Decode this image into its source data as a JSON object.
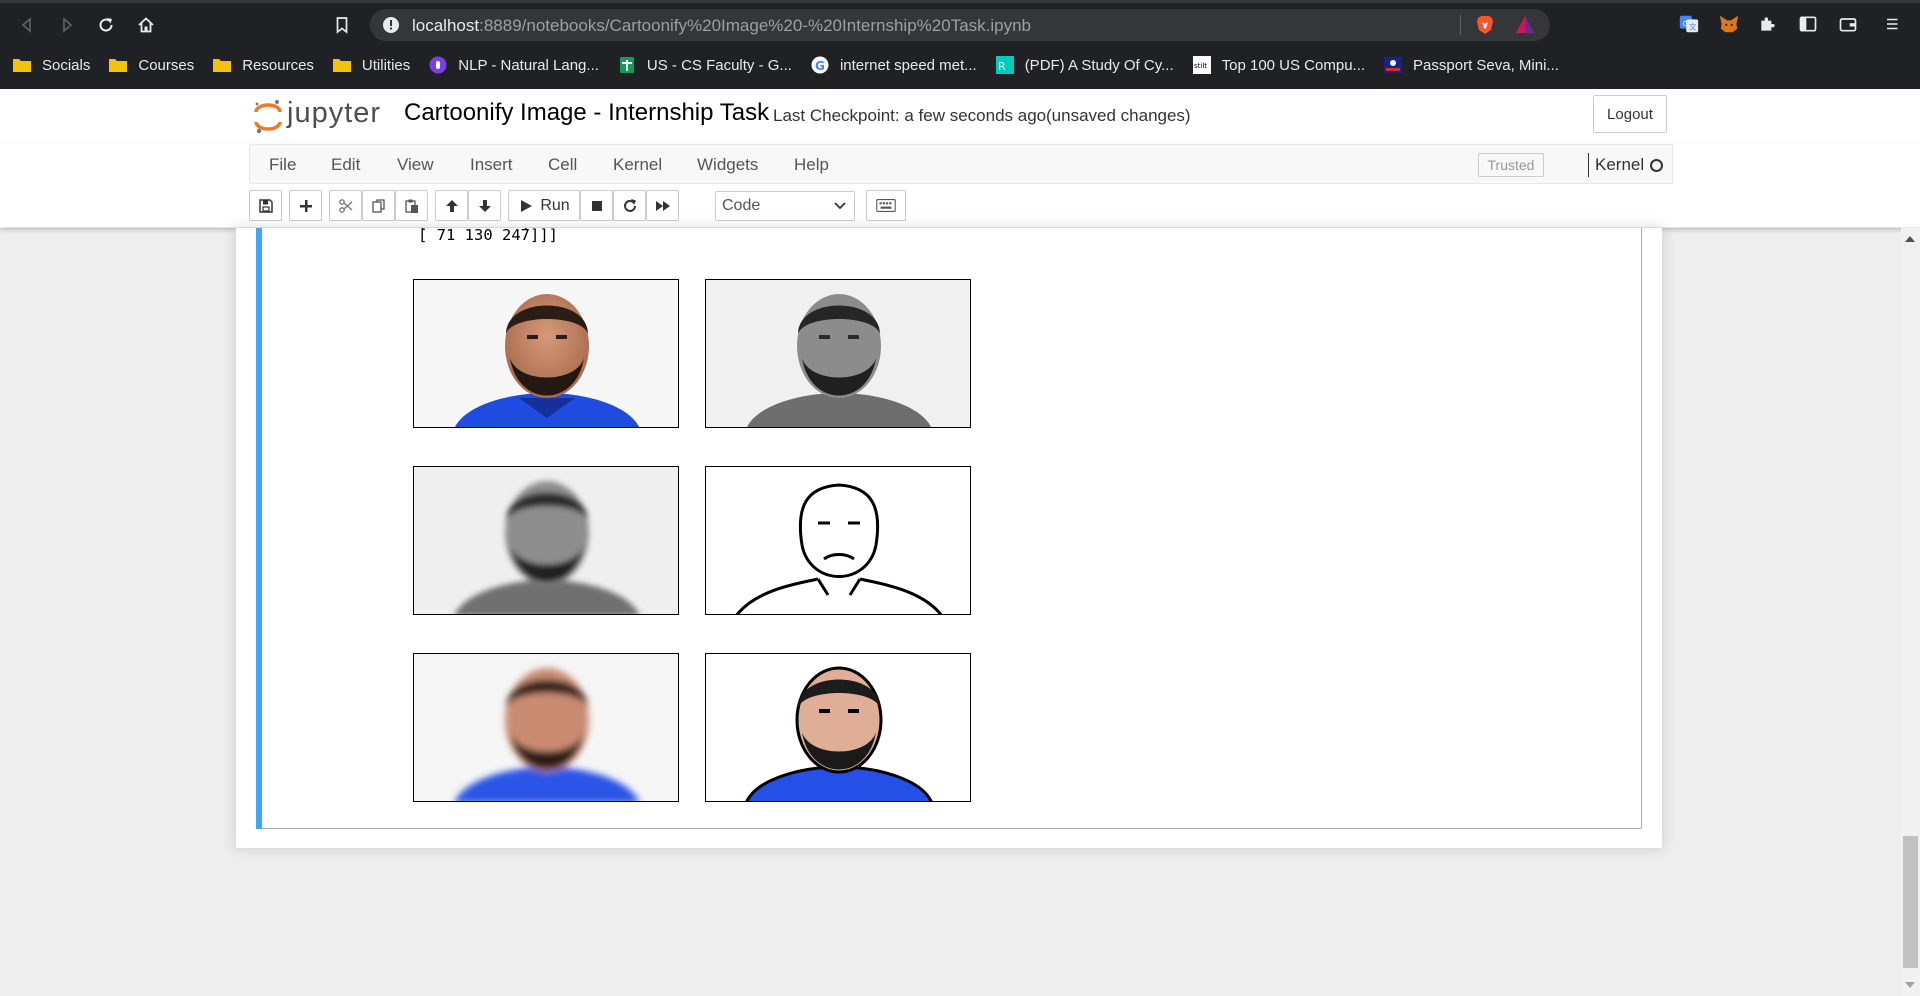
{
  "browser": {
    "url_host": "localhost",
    "url_path": ":8889/notebooks/Cartoonify%20Image%20-%20Internship%20Task.ipynb",
    "bookmarks": [
      {
        "label": "Socials",
        "icon": "folder-icon"
      },
      {
        "label": "Courses",
        "icon": "folder-icon"
      },
      {
        "label": "Resources",
        "icon": "folder-icon"
      },
      {
        "label": "Utilities",
        "icon": "folder-icon"
      },
      {
        "label": "NLP - Natural Lang...",
        "icon": "nlp-site-icon"
      },
      {
        "label": "US - CS Faculty - G...",
        "icon": "sheets-icon"
      },
      {
        "label": "internet speed met...",
        "icon": "google-icon"
      },
      {
        "label": "(PDF) A Study Of Cy...",
        "icon": "researchgate-icon"
      },
      {
        "label": "Top 100 US Compu...",
        "icon": "stilt-icon"
      },
      {
        "label": "Passport Seva, Mini...",
        "icon": "passport-icon"
      }
    ]
  },
  "jupyter": {
    "logo_text": "jupyter",
    "notebook_title": "Cartoonify Image - Internship Task",
    "checkpoint": "Last Checkpoint: a few seconds ago",
    "save_status": "(unsaved changes)",
    "logout_label": "Logout",
    "menus": [
      "File",
      "Edit",
      "View",
      "Insert",
      "Cell",
      "Kernel",
      "Widgets",
      "Help"
    ],
    "trusted_label": "Trusted",
    "kernel_label": "Kernel",
    "run_label": "Run",
    "cell_type": "Code"
  },
  "output": {
    "text_line": "[ 71 130 247]]]",
    "images": [
      {
        "name": "original-image",
        "style": "color"
      },
      {
        "name": "grayscale-image",
        "style": "gray"
      },
      {
        "name": "blurred-grayscale-image",
        "style": "gray-blur"
      },
      {
        "name": "edge-mask-image",
        "style": "edges"
      },
      {
        "name": "bilateral-filtered-image",
        "style": "color-blur"
      },
      {
        "name": "cartoon-image",
        "style": "cartoon"
      }
    ]
  },
  "colors": {
    "cell_selected_bar": "#42a5f5",
    "jupyter_orange": "#f37726",
    "shirt_blue": "#1f4be0"
  }
}
